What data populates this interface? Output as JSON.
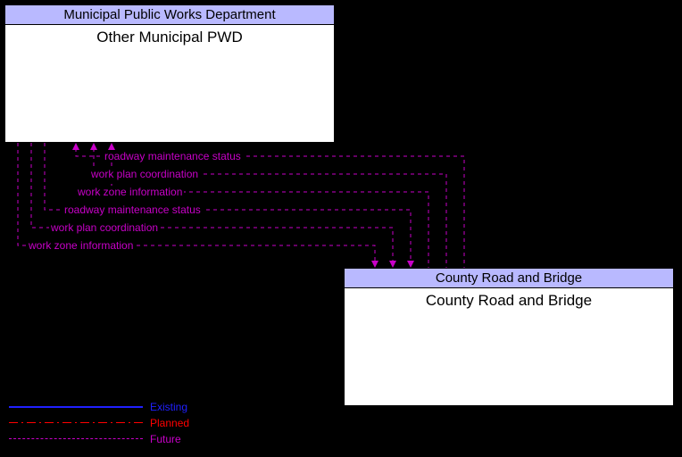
{
  "nodes": {
    "top": {
      "header": "Municipal Public Works Department",
      "body": "Other Municipal PWD"
    },
    "bottom": {
      "header": "County Road and Bridge",
      "body": "County Road and Bridge"
    }
  },
  "flows": {
    "to_top_1": "roadway maintenance status",
    "to_top_2": "work plan coordination",
    "to_top_3": "work zone information",
    "to_bottom_1": "roadway maintenance status",
    "to_bottom_2": "work plan coordination",
    "to_bottom_3": "work zone information"
  },
  "legend": {
    "existing": "Existing",
    "planned": "Planned",
    "future": "Future"
  },
  "colors": {
    "future": "#c800c8",
    "planned": "#ff0000",
    "existing": "#2020ff",
    "header_bg": "#b9b9ff"
  }
}
